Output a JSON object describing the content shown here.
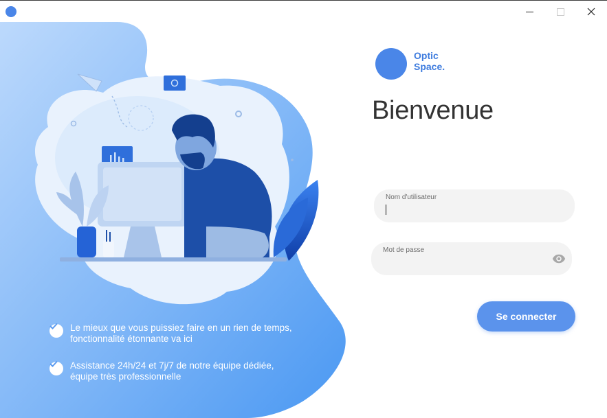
{
  "window": {
    "controls": [
      "minimize",
      "maximize",
      "close"
    ]
  },
  "features": [
    {
      "line1": "Le mieux que vous puissiez faire en un rien de temps,",
      "line2": "fonctionnalité étonnante va ici"
    },
    {
      "line1": "Assistance 24h/24 et 7j/7 de notre équipe dédiée,",
      "line2": "équipe très professionnelle"
    }
  ],
  "brand": {
    "line1": "Optic",
    "line2": "Space.",
    "color": "#3d7bde",
    "logo_color": "#4a86e8"
  },
  "login": {
    "title": "Bienvenue",
    "username_label": "Nom d'utilisateur",
    "username_value": "",
    "password_label": "Mot de passe",
    "password_value": "",
    "submit_label": "Se connecter"
  },
  "icons": {
    "app": "app-icon",
    "check": "check-circle-icon",
    "eye": "eye-icon"
  },
  "colors": {
    "accent": "#5b93ec",
    "panel_gradient_start": "#b9d7fb",
    "panel_gradient_end": "#4f9bf3"
  }
}
